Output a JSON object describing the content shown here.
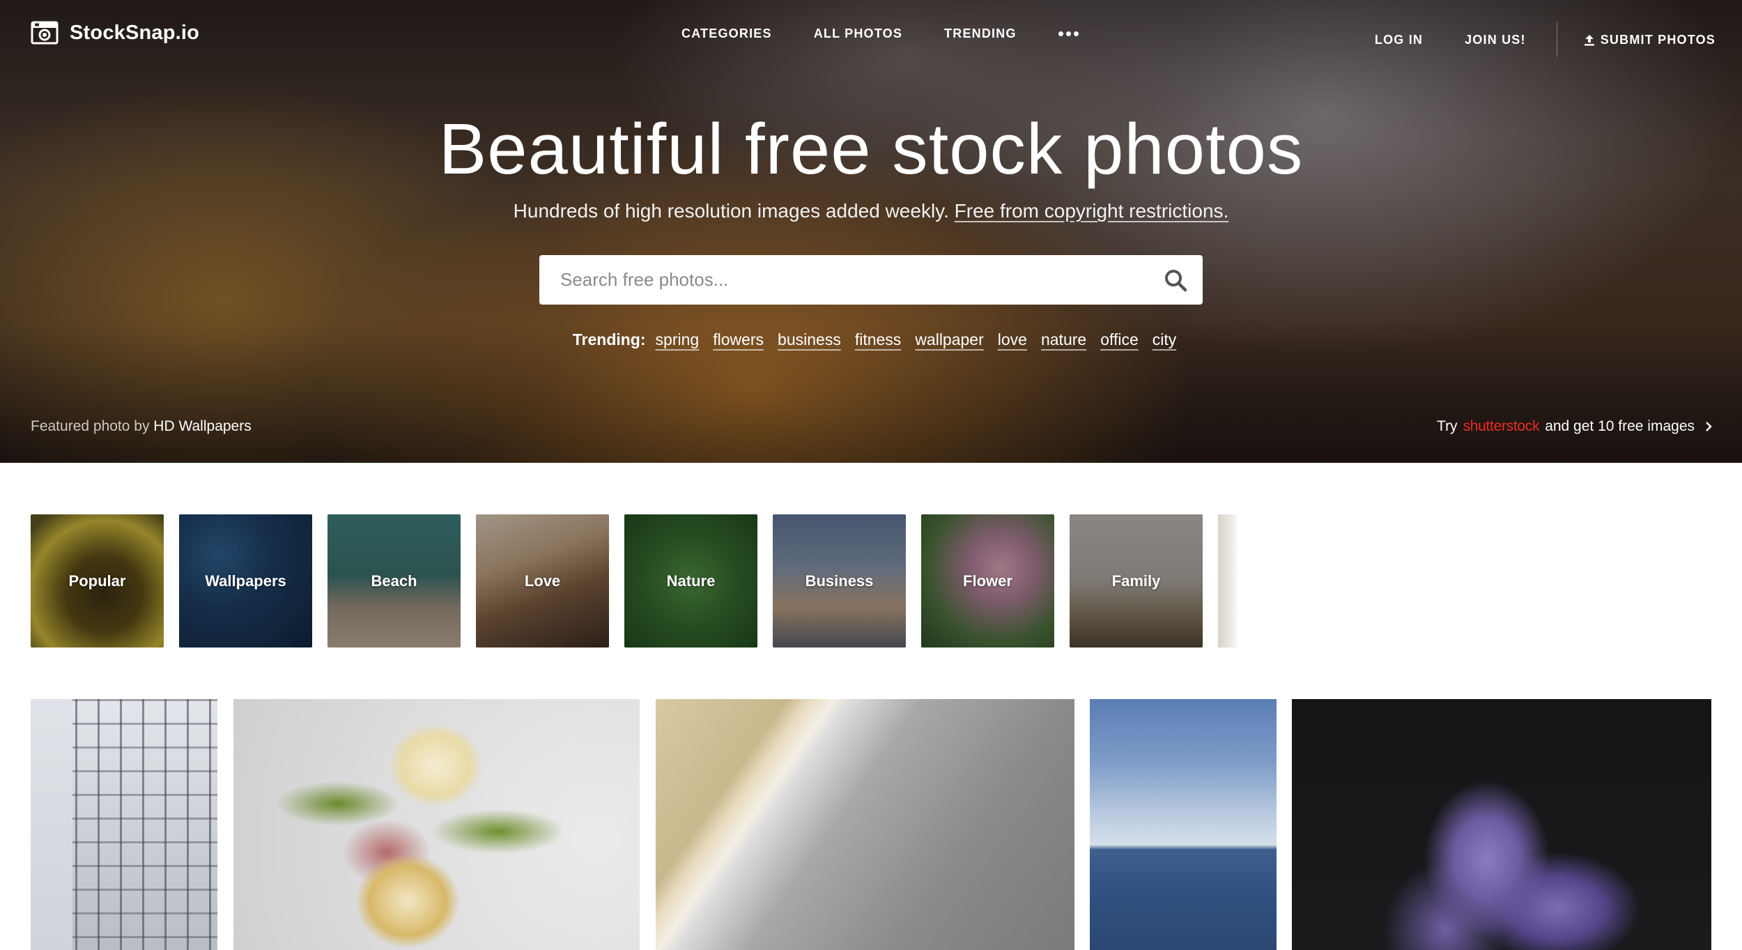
{
  "brand": {
    "name": "StockSnap.io"
  },
  "nav": {
    "links": [
      "CATEGORIES",
      "ALL PHOTOS",
      "TRENDING"
    ],
    "login": "LOG IN",
    "join": "JOIN US!",
    "submit": "SUBMIT PHOTOS"
  },
  "hero": {
    "title": "Beautiful free stock photos",
    "subtitle": "Hundreds of high resolution images added weekly.",
    "subtitle_link": "Free from copyright restrictions.",
    "search_placeholder": "Search free photos...",
    "trending_label": "Trending:",
    "trending_tags": [
      "spring",
      "flowers",
      "business",
      "fitness",
      "wallpaper",
      "love",
      "nature",
      "office",
      "city"
    ],
    "featured_prefix": "Featured photo by",
    "featured_author": "HD Wallpapers",
    "promo_prefix": "Try",
    "promo_brand": "shutterstock",
    "promo_suffix": "and get 10 free images"
  },
  "categories": [
    "Popular",
    "Wallpapers",
    "Beach",
    "Love",
    "Nature",
    "Business",
    "Flower",
    "Family"
  ],
  "colors": {
    "promo_brand": "#ee2b24",
    "text_on_hero": "#ffffff",
    "page_background": "#ffffff"
  },
  "icons": [
    "camera-logo-icon",
    "more-dots-icon",
    "upload-icon",
    "search-icon",
    "chevron-right-icon"
  ]
}
